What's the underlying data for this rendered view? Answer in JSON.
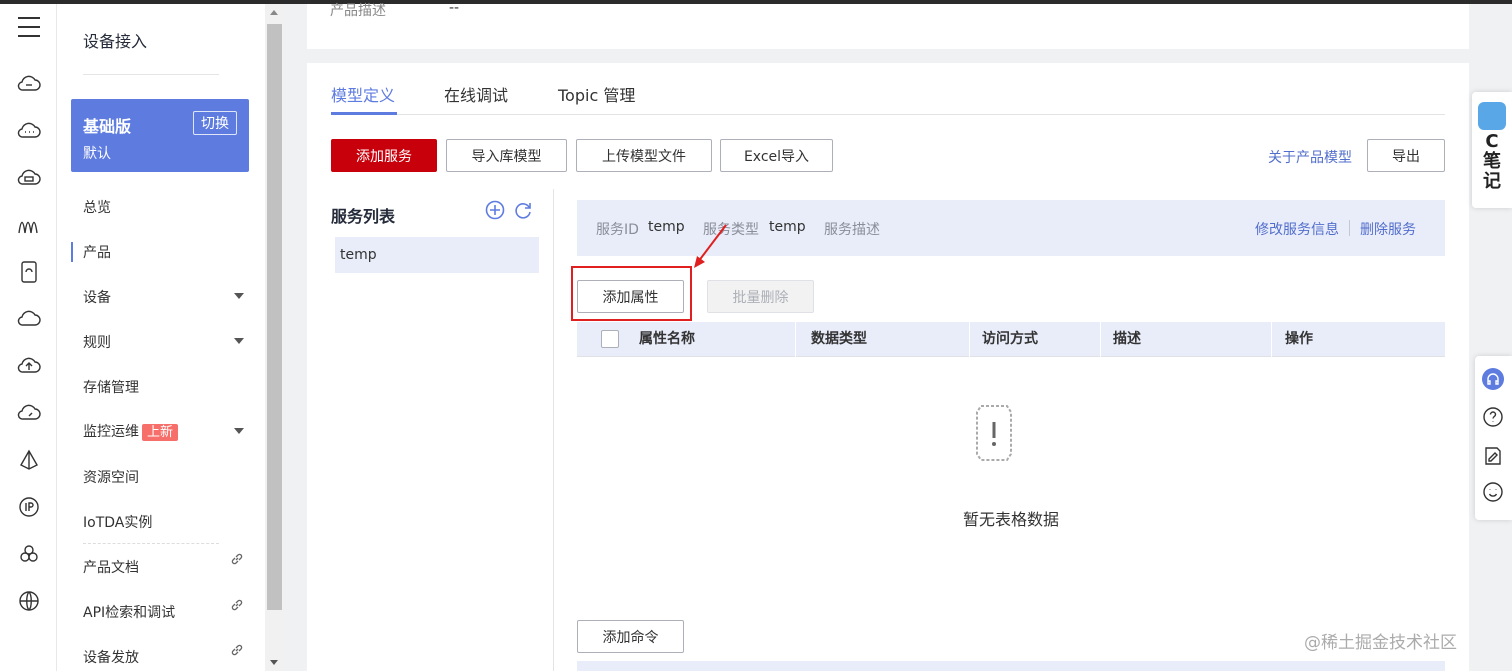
{
  "top_panel": {
    "label": "产品描述",
    "value": "--"
  },
  "sidebar": {
    "title": "设备接入",
    "plan": {
      "name": "基础版",
      "sub": "默认",
      "switch": "切换"
    },
    "items": [
      {
        "label": "总览"
      },
      {
        "label": "产品"
      },
      {
        "label": "设备"
      },
      {
        "label": "规则"
      },
      {
        "label": "存储管理"
      },
      {
        "label": "监控运维",
        "badge": "上新"
      },
      {
        "label": "资源空间"
      },
      {
        "label": "IoTDA实例"
      },
      {
        "label": "产品文档"
      },
      {
        "label": "API检索和调试"
      },
      {
        "label": "设备发放"
      }
    ]
  },
  "tabs": [
    "模型定义",
    "在线调试",
    "Topic 管理"
  ],
  "toolbar": {
    "add_service": "添加服务",
    "import_lib": "导入库模型",
    "upload_file": "上传模型文件",
    "excel_import": "Excel导入",
    "about_link": "关于产品模型",
    "export": "导出"
  },
  "service_list": {
    "title": "服务列表",
    "items": [
      "temp"
    ]
  },
  "service_info": {
    "id_label": "服务ID",
    "id_value": "temp",
    "type_label": "服务类型",
    "type_value": "temp",
    "desc_label": "服务描述",
    "edit_link": "修改服务信息",
    "delete_link": "删除服务"
  },
  "property_actions": {
    "add": "添加属性",
    "batch_delete": "批量删除"
  },
  "table": {
    "columns": [
      "属性名称",
      "数据类型",
      "访问方式",
      "描述",
      "操作"
    ],
    "empty_text": "暂无表格数据"
  },
  "command_actions": {
    "add": "添加命令"
  },
  "float_note": {
    "text": "C 笔 记"
  },
  "watermark": "@稀土掘金技术社区",
  "colors": {
    "primary": "#c7000b",
    "accent": "#5e7ce0",
    "link": "#526ecc",
    "highlight": "#e02020"
  }
}
